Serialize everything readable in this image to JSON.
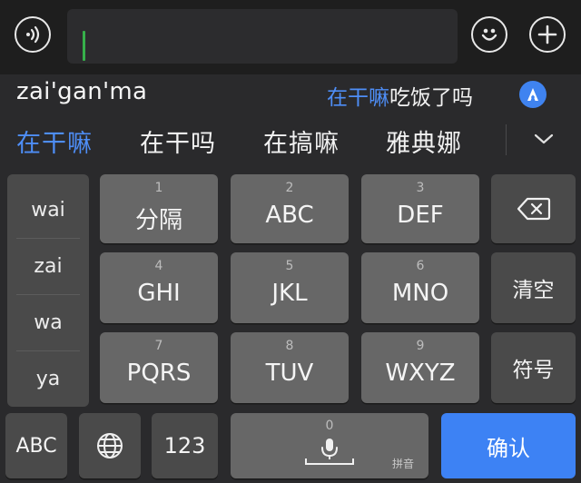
{
  "input_bar": {
    "voice_icon": "voice-wave-icon",
    "emoji_icon": "smiley-icon",
    "plus_icon": "plus-icon"
  },
  "composition": {
    "pinyin": "zai'gan'ma",
    "prediction_highlight": "在干嘛",
    "prediction_rest": "吃饭了吗",
    "assistant_icon": "ai-assistant-icon"
  },
  "candidates": {
    "items": [
      "在干嘛",
      "在干吗",
      "在搞嘛",
      "雅典娜"
    ],
    "expand_icon": "chevron-down-icon"
  },
  "keyboard": {
    "side_pinyin": [
      "wai",
      "zai",
      "wa",
      "ya"
    ],
    "keys": [
      {
        "num": "1",
        "label": "分隔"
      },
      {
        "num": "2",
        "label": "ABC"
      },
      {
        "num": "3",
        "label": "DEF"
      },
      {
        "num": "4",
        "label": "GHI"
      },
      {
        "num": "5",
        "label": "JKL"
      },
      {
        "num": "6",
        "label": "MNO"
      },
      {
        "num": "7",
        "label": "PQRS"
      },
      {
        "num": "8",
        "label": "TUV"
      },
      {
        "num": "9",
        "label": "WXYZ"
      }
    ],
    "backspace_icon": "backspace-icon",
    "clear_label": "清空",
    "symbols_label": "符号",
    "abc_label": "ABC",
    "globe_icon": "globe-icon",
    "num123_label": "123",
    "space_num": "0",
    "space_tag": "拼音",
    "mic_icon": "microphone-icon",
    "confirm_label": "确认"
  }
}
